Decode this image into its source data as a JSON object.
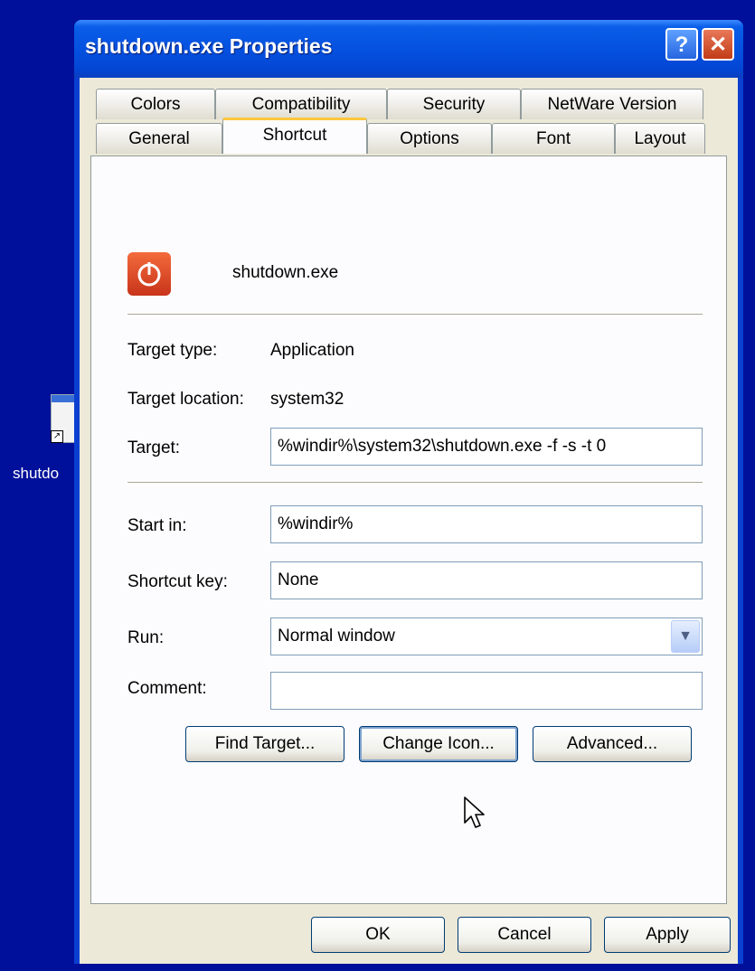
{
  "desktop": {
    "icon_label": "shutdo"
  },
  "window": {
    "title": "shutdown.exe Properties",
    "help_label": "?",
    "close_label": "✕"
  },
  "tabs": {
    "row1": [
      "Colors",
      "Compatibility",
      "Security",
      "NetWare Version"
    ],
    "row2": [
      "General",
      "Shortcut",
      "Options",
      "Font",
      "Layout"
    ],
    "active": "Shortcut"
  },
  "shortcut": {
    "name": "shutdown.exe",
    "target_type_label": "Target type:",
    "target_type_value": "Application",
    "target_location_label": "Target location:",
    "target_location_value": "system32",
    "target_label": "Target:",
    "target_value": "%windir%\\system32\\shutdown.exe -f -s -t 0",
    "start_in_label": "Start in:",
    "start_in_value": "%windir%",
    "shortcut_key_label": "Shortcut key:",
    "shortcut_key_value": "None",
    "run_label": "Run:",
    "run_value": "Normal window",
    "comment_label": "Comment:",
    "comment_value": "",
    "find_target": "Find Target...",
    "change_icon": "Change Icon...",
    "advanced": "Advanced..."
  },
  "footer": {
    "ok": "OK",
    "cancel": "Cancel",
    "apply": "Apply"
  },
  "colors": {
    "desktop": "#00109a",
    "titlebar": "#0551e0",
    "active_tab_highlight": "#ffc83c",
    "icon_red": "#d9411f"
  },
  "icons": {
    "app": "power-icon",
    "cursor": "mouse-pointer-icon",
    "dropdown": "chevron-down-icon"
  }
}
